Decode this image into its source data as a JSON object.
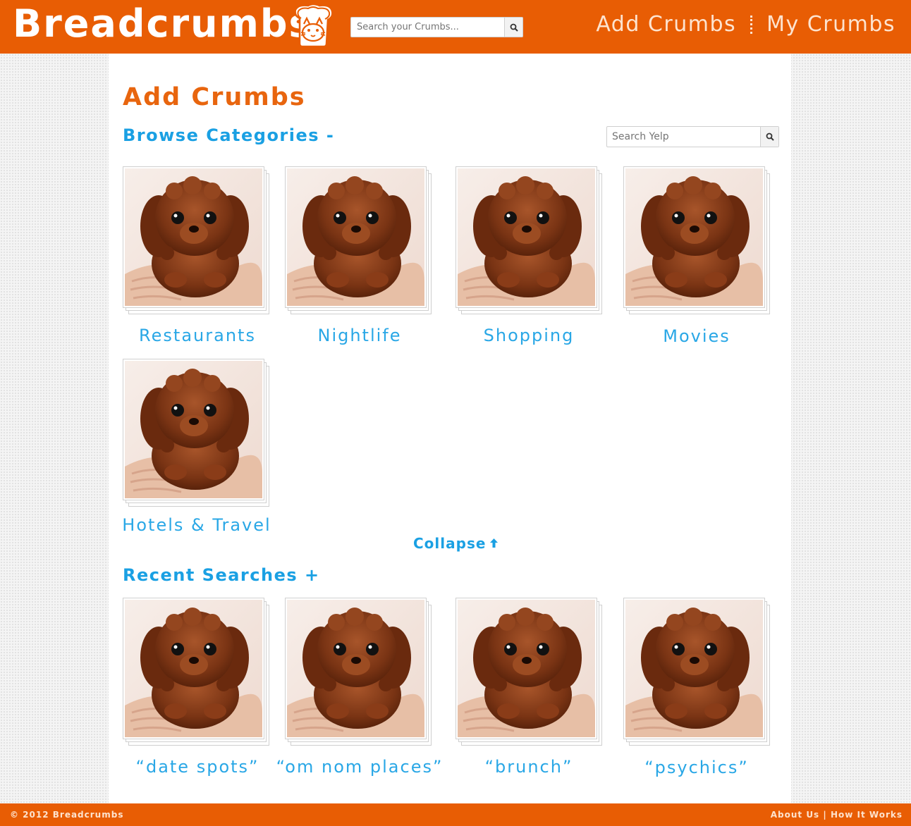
{
  "header": {
    "logo_text": "Breadcrumbs",
    "search_placeholder": "Search your Crumbs...",
    "nav": {
      "add_crumbs": "Add Crumbs",
      "my_crumbs": "My Crumbs"
    }
  },
  "main": {
    "page_title": "Add Crumbs",
    "browse": {
      "title": "Browse Categories -",
      "yelp_placeholder": "Search Yelp",
      "categories": [
        {
          "label": "Restaurants"
        },
        {
          "label": "Nightlife"
        },
        {
          "label": "Shopping"
        },
        {
          "label": "Movies"
        },
        {
          "label": "Hotels & Travel"
        }
      ],
      "collapse_label": "Collapse"
    },
    "recent": {
      "title": "Recent Searches +",
      "searches": [
        {
          "label": "“date spots”"
        },
        {
          "label": "“om nom places”"
        },
        {
          "label": "“brunch”"
        },
        {
          "label": "“psychics”"
        }
      ]
    }
  },
  "footer": {
    "copyright": "© 2012 Breadcrumbs",
    "about": "About Us",
    "separator": "|",
    "how": "How It Works"
  },
  "colors": {
    "brand": "#e85d04",
    "title": "#e8650e",
    "accent": "#1aa0e3"
  }
}
